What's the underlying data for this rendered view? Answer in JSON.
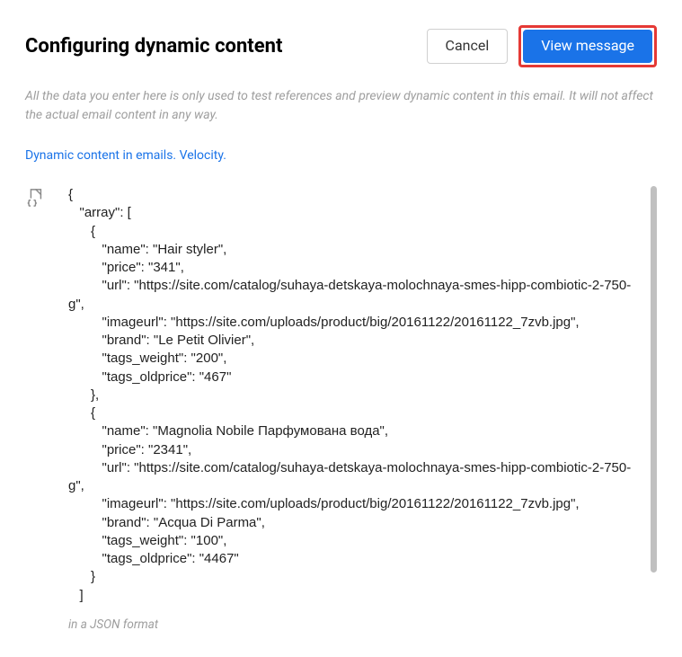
{
  "header": {
    "title": "Configuring dynamic content",
    "cancel_label": "Cancel",
    "view_label": "View message"
  },
  "description": "All the data you enter here is only used to test references and preview dynamic content in this email. It will not affect the actual email content in any way.",
  "link_text": "Dynamic content in emails. Velocity.",
  "code_text": "{\n   \"array\": [\n      {\n         \"name\": \"Hair styler\",\n         \"price\": \"341\",\n         \"url\": \"https://site.com/catalog/suhaya-detskaya-molochnaya-smes-hipp-combiotic-2-750-g\",\n         \"imageurl\": \"https://site.com/uploads/product/big/20161122/20161122_7zvb.jpg\",\n         \"brand\": \"Le Petit Olivier\",\n         \"tags_weight\": \"200\",\n         \"tags_oldprice\": \"467\"\n      },\n      {\n         \"name\": \"Magnolia Nobile Парфумована вода\",\n         \"price\": \"2341\",\n         \"url\": \"https://site.com/catalog/suhaya-detskaya-molochnaya-smes-hipp-combiotic-2-750-g\",\n         \"imageurl\": \"https://site.com/uploads/product/big/20161122/20161122_7zvb.jpg\",\n         \"brand\": \"Acqua Di Parma\",\n         \"tags_weight\": \"100\",\n         \"tags_oldprice\": \"4467\"\n      }\n   ]\n",
  "footer_note": "in a JSON format"
}
